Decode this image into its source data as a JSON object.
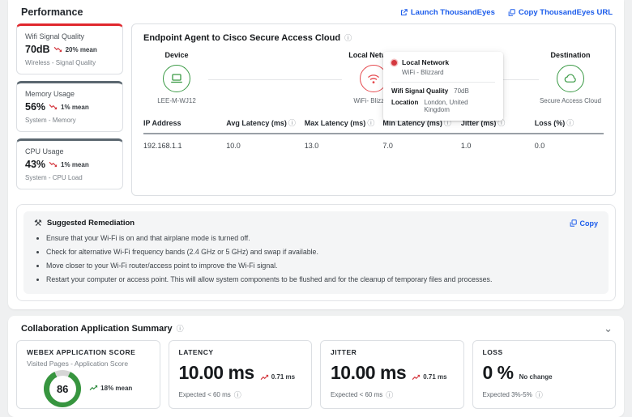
{
  "colors": {
    "accent_red": "#e0282e",
    "accent_slate": "#5b6770",
    "link_blue": "#1b5ceb",
    "node_green": "#3a9a45",
    "node_red": "#e5484d",
    "trend_red": "#d4373e",
    "trend_green": "#2e8b3e"
  },
  "page": {
    "title": "Performance",
    "launch_link": "Launch ThousandEyes",
    "copy_link": "Copy ThousandEyes URL"
  },
  "metrics": [
    {
      "title": "Wifi Signal Quality",
      "value": "70dB",
      "trend": "20% mean",
      "subtitle": "Wireless - Signal Quality",
      "accent": "#e0282e"
    },
    {
      "title": "Memory Usage",
      "value": "56%",
      "trend": "1% mean",
      "subtitle": "System - Memory",
      "accent": "#5b6770"
    },
    {
      "title": "CPU Usage",
      "value": "43%",
      "trend": "1% mean",
      "subtitle": "System - CPU Load",
      "accent": "#5b6770"
    }
  ],
  "endpoint": {
    "title": "Endpoint Agent to Cisco Secure Access Cloud",
    "nodes": {
      "device": {
        "label": "Device",
        "name": "LEE-M-WJ12"
      },
      "local_network": {
        "label": "Local Network",
        "name": "WiFi- Blizzard"
      },
      "destination": {
        "label": "Destination",
        "name": "Secure Access Cloud"
      }
    },
    "tooltip": {
      "title": "Local Network",
      "subtitle": "WiFi - Blizzard",
      "signal_label": "Wifi Signal Quality",
      "signal_value": "70dB",
      "location_label": "Location",
      "location_value": "London, United Kingdom"
    },
    "table": {
      "headers": [
        "IP Address",
        "Avg Latency (ms)",
        "Max Latency (ms)",
        "Min Latency (ms)",
        "Jitter (ms)",
        "Loss (%)"
      ],
      "row": [
        "192.168.1.1",
        "10.0",
        "13.0",
        "7.0",
        "1.0",
        "0.0"
      ]
    }
  },
  "remediation": {
    "title": "Suggested Remediation",
    "copy_label": "Copy",
    "items": [
      "Ensure that your Wi-Fi is on and that airplane mode is turned off.",
      "Check for alternative Wi-Fi frequency bands (2.4 GHz or 5 GHz) and swap if available.",
      "Move closer to your Wi-Fi router/access point to improve the Wi-Fi signal.",
      "Restart your computer or access point. This will allow system components to be flushed and for the cleanup of temporary files and processes."
    ]
  },
  "collab": {
    "title": "Collaboration Application Summary",
    "webex": {
      "title": "WEBEX APPLICATION SCORE",
      "subtitle": "Visited Pages - Application Score",
      "score": "86",
      "trend": "18% mean"
    },
    "latency": {
      "title": "LATENCY",
      "value": "10.00 ms",
      "trend": "0.71 ms",
      "expected": "Expected < 60 ms"
    },
    "jitter": {
      "title": "JITTER",
      "value": "10.00 ms",
      "trend": "0.71 ms",
      "expected": "Expected < 60 ms"
    },
    "loss": {
      "title": "LOSS",
      "value": "0 %",
      "trend": "No change",
      "expected": "Expected 3%-5%"
    }
  }
}
